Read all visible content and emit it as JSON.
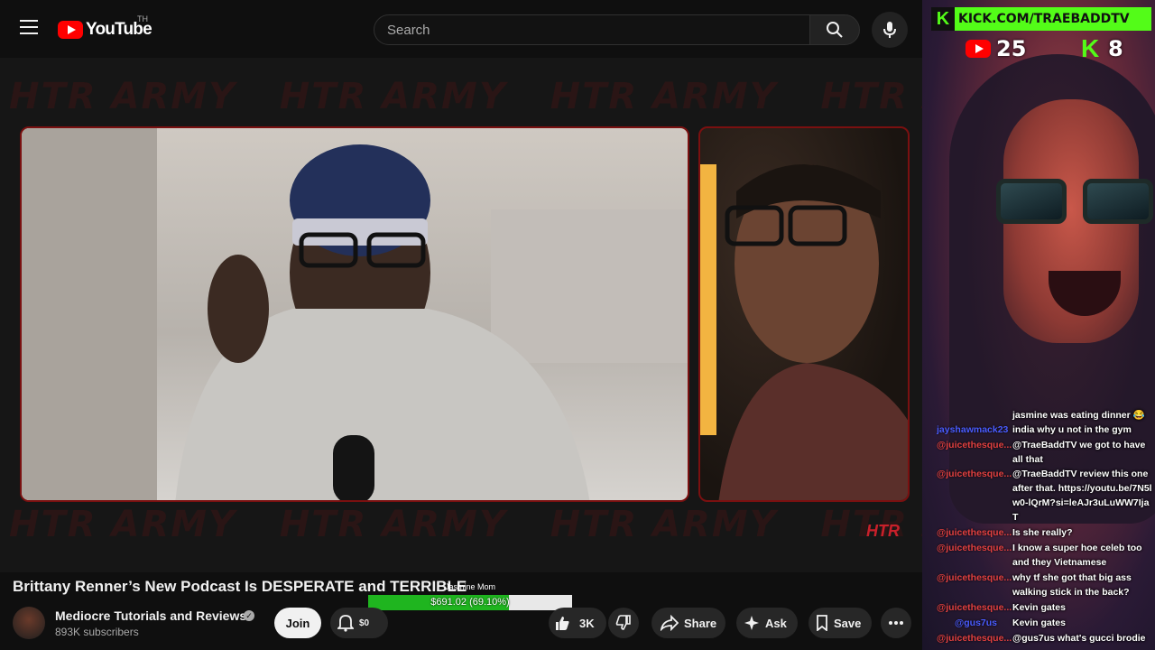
{
  "header": {
    "logo_text": "YouTube",
    "logo_region": "TH",
    "search_placeholder": "Search"
  },
  "video": {
    "watermark": "HTR ARMY",
    "badge": "HTR"
  },
  "title": "Brittany Renner’s New Podcast Is DESPERATE and TERRIBLE",
  "goal": {
    "label": "Jasmine Mom",
    "amount": "$691.02 (69.10%)",
    "progress": 0.691
  },
  "channel": {
    "name": "Mediocre Tutorials and Reviews",
    "subscribers": "893K subscribers"
  },
  "actions": {
    "join": "Join",
    "bell_amount": "$0",
    "likes": "3K",
    "share": "Share",
    "ask": "Ask",
    "save": "Save"
  },
  "stream": {
    "kick_url": "KICK.COM/TRAEBADDTV",
    "youtube_viewers": "25",
    "kick_viewers": "8"
  },
  "chat": [
    {
      "user": "",
      "text": "jasmine was eating dinner 😂",
      "color": "red"
    },
    {
      "user": "jayshawmack23",
      "text": "india why u not in the gym",
      "color": "blue"
    },
    {
      "user": "@juicethesque...",
      "text": "@TraeBaddTV we got to have all that",
      "color": "red"
    },
    {
      "user": "@juicethesque...",
      "text": "@TraeBaddTV review this one after that. https://youtu.be/7N5lw0-lQrM?si=leAJr3uLuWW7IjaT",
      "color": "red"
    },
    {
      "user": "@juicethesque...",
      "text": "Is she really?",
      "color": "red"
    },
    {
      "user": "@juicethesque...",
      "text": "I know a super hoe celeb too and they Vietnamese",
      "color": "red"
    },
    {
      "user": "@juicethesque...",
      "text": "why tf she got that big ass walking stick in the back?",
      "color": "red"
    },
    {
      "user": "@juicethesque...",
      "text": "Kevin gates",
      "color": "red"
    },
    {
      "user": "@gus7us",
      "text": "Kevin gates",
      "color": "blue"
    },
    {
      "user": "@juicethesque...",
      "text": "@gus7us what's gucci brodie",
      "color": "red"
    }
  ],
  "colors": {
    "yt_red": "#ff0000",
    "kick_green": "#53fc18",
    "goal_green": "#1fb51f",
    "frame_red": "#7a1010"
  }
}
